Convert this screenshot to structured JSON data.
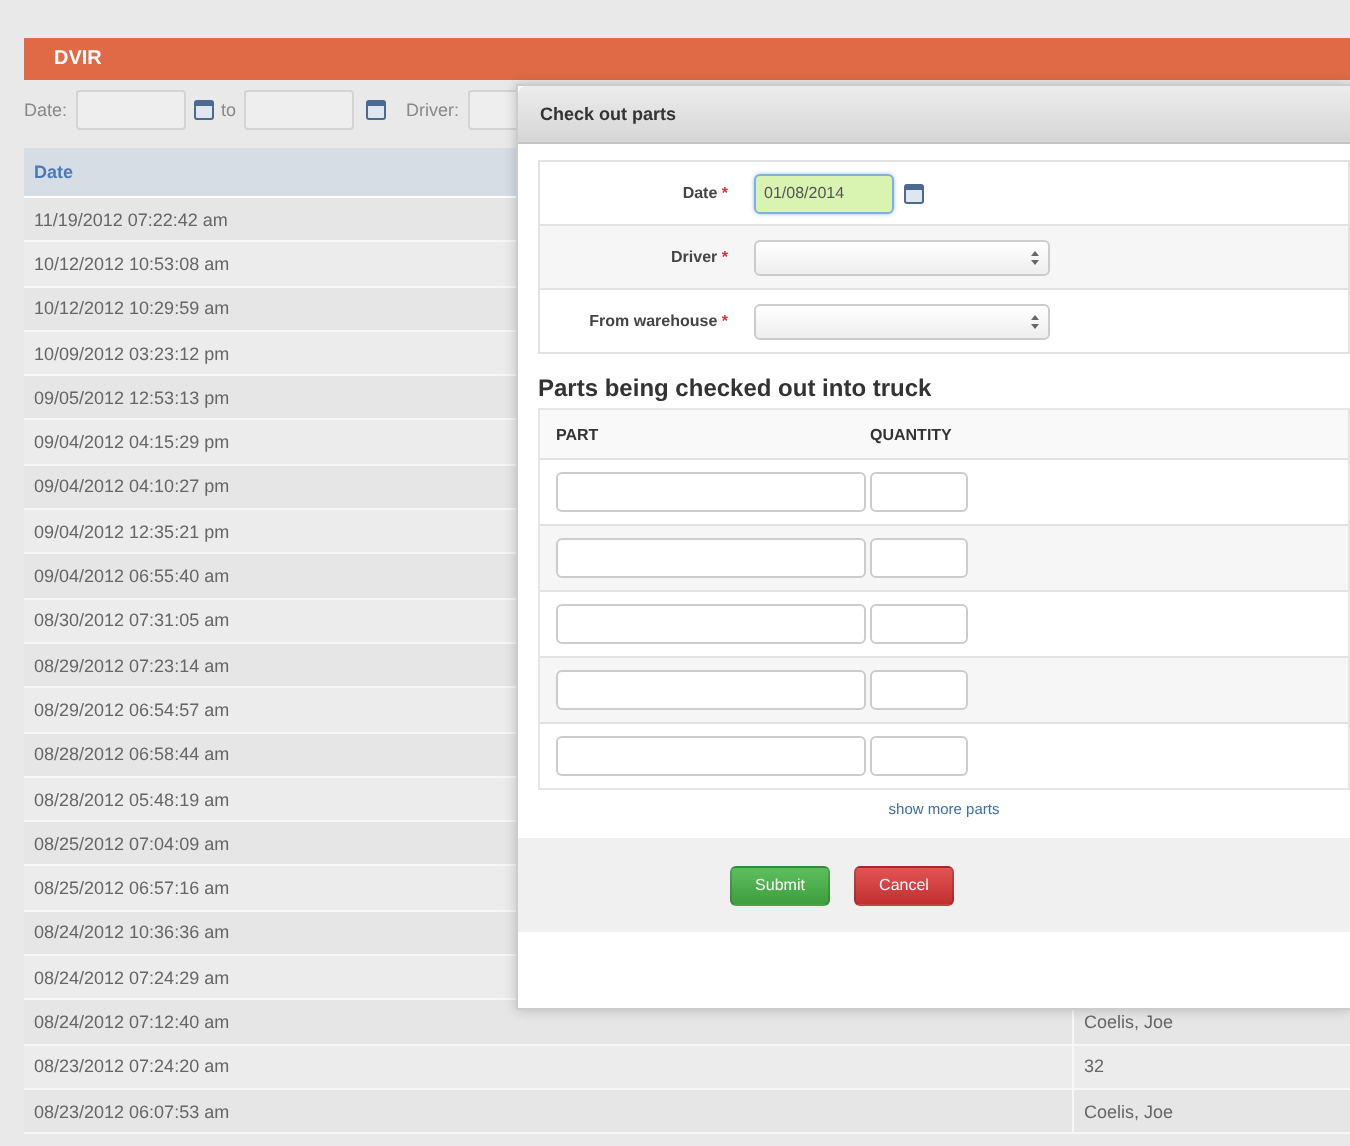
{
  "page": {
    "title": "DVIR"
  },
  "filters": {
    "date_label": "Date:",
    "to_label": "to",
    "driver_label": "Driver:"
  },
  "table": {
    "columns": [
      "Date"
    ],
    "rows": [
      {
        "date": "11/19/2012 07:22:42 am"
      },
      {
        "date": "10/12/2012 10:53:08 am"
      },
      {
        "date": "10/12/2012 10:29:59 am"
      },
      {
        "date": "10/09/2012 03:23:12 pm"
      },
      {
        "date": "09/05/2012 12:53:13 pm"
      },
      {
        "date": "09/04/2012 04:15:29 pm"
      },
      {
        "date": "09/04/2012 04:10:27 pm"
      },
      {
        "date": "09/04/2012 12:35:21 pm"
      },
      {
        "date": "09/04/2012 06:55:40 am"
      },
      {
        "date": "08/30/2012 07:31:05 am"
      },
      {
        "date": "08/29/2012 07:23:14 am"
      },
      {
        "date": "08/29/2012 06:54:57 am"
      },
      {
        "date": "08/28/2012 06:58:44 am"
      },
      {
        "date": "08/28/2012 05:48:19 am"
      },
      {
        "date": "08/25/2012 07:04:09 am"
      },
      {
        "date": "08/25/2012 06:57:16 am"
      },
      {
        "date": "08/24/2012 10:36:36 am"
      },
      {
        "date": "08/24/2012 07:24:29 am"
      },
      {
        "date": "08/24/2012 07:12:40 am",
        "column_2": "Coelis, Joe"
      },
      {
        "date": "08/23/2012 07:24:20 am",
        "column_2": "32"
      },
      {
        "date": "08/23/2012 06:07:53 am",
        "column_2": "Coelis, Joe"
      }
    ]
  },
  "dialog": {
    "title": "Check out parts",
    "fields": [
      {
        "kind": "date",
        "label": "Date",
        "mark": "*",
        "value": "01/08/2014",
        "focused": true
      },
      {
        "kind": "select",
        "label": "Driver",
        "mark": "*"
      },
      {
        "kind": "select",
        "label": "From warehouse",
        "mark": "*"
      }
    ],
    "section_title": "Parts being checked out into truck",
    "parts_columns": [
      "PART",
      "QUANTITY"
    ],
    "part_rows": [
      {
        "kind": "empty"
      },
      {
        "kind": "empty"
      },
      {
        "kind": "empty"
      },
      {
        "kind": "empty"
      },
      {
        "kind": "empty"
      }
    ],
    "show_more": "show more parts",
    "buttons": [
      {
        "label": "Submit",
        "kind": "primary"
      },
      {
        "label": "Cancel",
        "kind": "danger"
      }
    ]
  }
}
